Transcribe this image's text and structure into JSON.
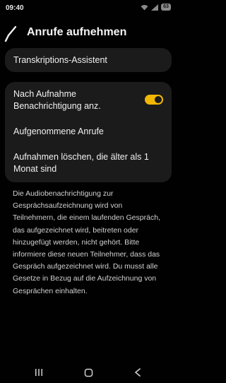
{
  "status": {
    "time": "09:40",
    "battery": "63"
  },
  "header": {
    "title": "Anrufe aufnehmen"
  },
  "items": {
    "transcription": "Transkriptions-Assistent",
    "notify_after_recording": "Nach Aufnahme Benachrichtigung anz.",
    "notify_toggle_on": true,
    "recorded_calls": "Aufgenommene Anrufe",
    "delete_old": "Aufnahmen löschen, die älter als 1 Monat sind"
  },
  "description": "Die Audiobenachrichtigung zur Gesprächsaufzeichnung wird von Teilnehmern, die einem laufenden Gespräch, das aufgezeichnet wird, beitreten oder hinzugefügt werden, nicht gehört. Bitte informiere diese neuen Teilnehmer, dass das Gespräch aufgezeichnet wird. Du musst alle Gesetze in Bezug auf die Aufzeichnung von Gesprächen einhalten.",
  "colors": {
    "accent": "#f2b705",
    "card": "#1b1b1b",
    "background": "#010101"
  },
  "icons": {
    "back": "back-arrow-icon",
    "nav_recents": "recents-icon",
    "nav_home": "home-icon",
    "nav_back": "nav-back-icon"
  }
}
